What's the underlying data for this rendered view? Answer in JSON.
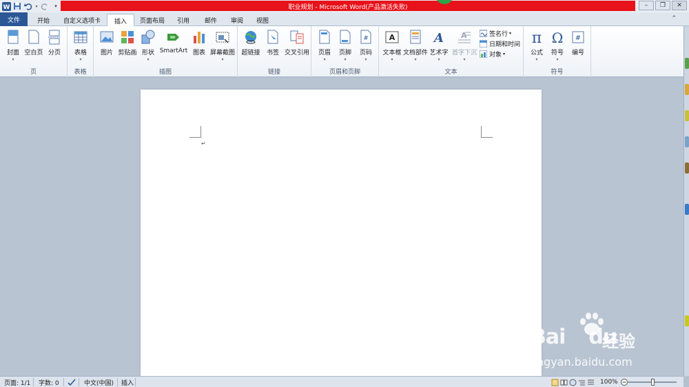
{
  "app": {
    "title": "职业规划 - Microsoft Word(产品激活失败)"
  },
  "tabs": {
    "file": "文件",
    "home": "开始",
    "custom": "自定义选项卡",
    "insert": "插入",
    "layout": "页面布局",
    "references": "引用",
    "mailings": "邮件",
    "review": "审阅",
    "view": "视图"
  },
  "ribbon": {
    "pages": {
      "label": "页",
      "cover": "封面",
      "blank": "空白页",
      "break": "分页"
    },
    "tables": {
      "label": "表格",
      "table": "表格"
    },
    "illustrations": {
      "label": "插图",
      "picture": "图片",
      "clipart": "剪贴画",
      "shapes": "形状",
      "smartart": "SmartArt",
      "chart": "图表",
      "screenshot": "屏幕截图"
    },
    "links": {
      "label": "链接",
      "hyperlink": "超链接",
      "bookmark": "书签",
      "crossref": "交叉引用"
    },
    "headerfooter": {
      "label": "页眉和页脚",
      "header": "页眉",
      "footer": "页脚",
      "pagenum": "页码"
    },
    "text": {
      "label": "文本",
      "textbox": "文本框",
      "quickparts": "文档部件",
      "wordart": "艺术字",
      "dropcap": "首字下沉",
      "signature": "签名行",
      "datetime": "日期和时间",
      "object": "对象"
    },
    "symbols": {
      "label": "符号",
      "equation": "公式",
      "symbol": "符号",
      "number": "编号"
    }
  },
  "document": {
    "paragraph_mark": "↵"
  },
  "watermark": {
    "brand": "Bai",
    "brand2": "du",
    "cn": "经验",
    "url": "jingyan.baidu.com"
  },
  "status": {
    "page": "页面: 1/1",
    "words": "字数: 0",
    "language": "中文(中国)",
    "mode": "插入",
    "zoom": "100%"
  },
  "colors": {
    "title_bar": "#e8121a",
    "file_tab": "#2b5797"
  }
}
